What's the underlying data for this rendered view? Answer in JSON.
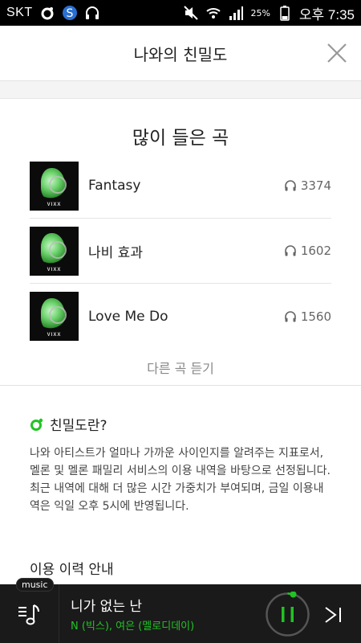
{
  "status_bar": {
    "carrier": "SKT",
    "battery": "25%",
    "time": "오후 7:35"
  },
  "header": {
    "title": "나와의 친밀도"
  },
  "most_played": {
    "title": "많이 들은 곡",
    "songs": [
      {
        "title": "Fantasy",
        "plays": "3374"
      },
      {
        "title": "나비 효과",
        "plays": "1602"
      },
      {
        "title": "Love Me Do",
        "plays": "1560"
      }
    ],
    "album_text": "VIXX",
    "more_label": "다른 곡 듣기"
  },
  "intimacy": {
    "title": "친밀도란?",
    "body": "나와 아티스트가 얼마나 가까운 사이인지를 알려주는 지표로서, 멜론 및 멜론 패밀리 서비스의 이용 내역을 바탕으로 선정됩니다. 최근 내역에 대해 더 많은 시간 가중치가 부여되며, 금일 이용내역은 익일 오후 5시에 반영됩니다.",
    "usage_title": "이용 이력 안내"
  },
  "player": {
    "tag": "music",
    "track_title": "니가 없는 난",
    "track_artist": "N (빅스), 여은 (멜로디데이)"
  },
  "colors": {
    "accent": "#22c325",
    "player_bg": "#1a1a1a"
  },
  "icons": {
    "close": "close-icon",
    "headphones": "headphones-icon",
    "intimacy": "ring-icon",
    "playlist": "music-note-icon",
    "pause": "pause-icon",
    "next": "next-track-icon"
  }
}
